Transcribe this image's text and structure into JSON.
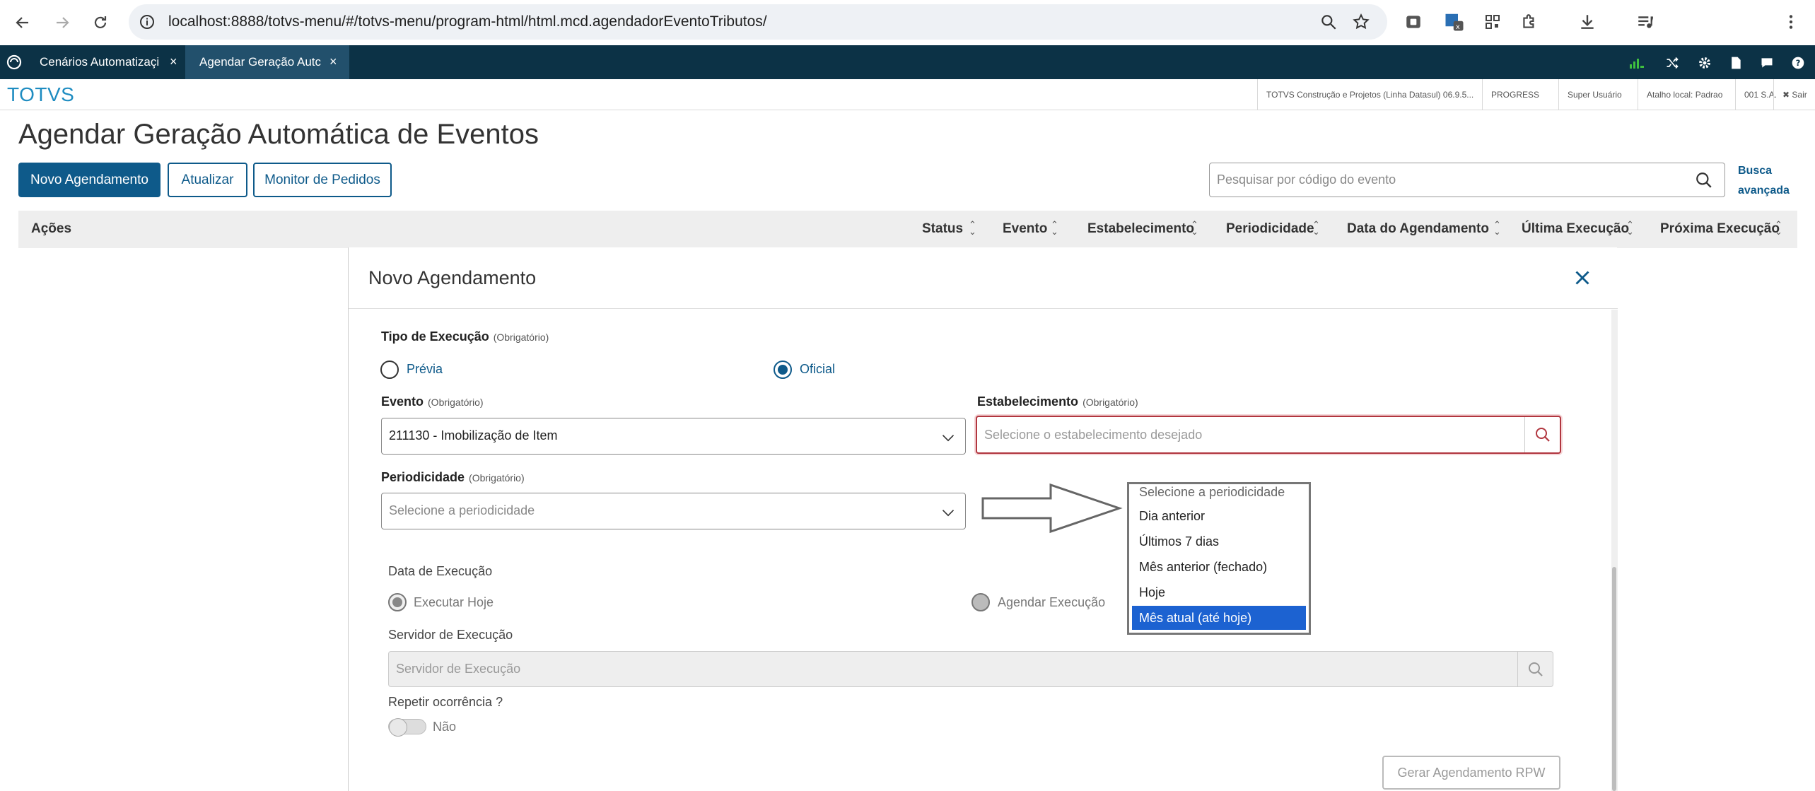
{
  "browser": {
    "url": "localhost:8888/totvs-menu/#/totvs-menu/program-html/html.mcd.agendadorEventoTributos/"
  },
  "app_tabs": [
    {
      "label": "Cenários Automatizaçi",
      "close": "×"
    },
    {
      "label": "Agendar Geração Autc",
      "close": "×"
    }
  ],
  "info_bar": {
    "brand": "TOTVS",
    "items": [
      "TOTVS Construção e Projetos (Linha Datasul) 06.9.5...",
      "PROGRESS",
      "Super Usuário",
      "Atalho local: Padrao",
      "001 S.A.",
      "✖ Sair"
    ]
  },
  "page": {
    "title": "Agendar Geração Automática de Eventos",
    "buttons": {
      "new": "Novo Agendamento",
      "refresh": "Atualizar",
      "monitor": "Monitor de Pedidos"
    },
    "search_placeholder": "Pesquisar por código do evento",
    "advanced_search_line1": "Busca",
    "advanced_search_line2": "avançada"
  },
  "table": {
    "actions_header": "Ações",
    "columns": [
      "Status",
      "Evento",
      "Estabelecimento",
      "Periodicidade",
      "Data do Agendamento",
      "Última Execução",
      "Próxima Execução"
    ]
  },
  "modal": {
    "title": "Novo Agendamento",
    "required_tag": "(Obrigatório)",
    "tipo_label": "Tipo de Execução",
    "tipo_options": [
      "Prévia",
      "Oficial"
    ],
    "tipo_selected": "Oficial",
    "evento_label": "Evento",
    "evento_value": "211130 - Imobilização de Item",
    "estab_label": "Estabelecimento",
    "estab_placeholder": "Selecione o estabelecimento desejado",
    "period_label": "Periodicidade",
    "period_placeholder": "Selecione a periodicidade",
    "data_label": "Data de Execução",
    "data_options": [
      "Executar Hoje",
      "Agendar Execução"
    ],
    "servidor_label": "Servidor de Execução",
    "servidor_placeholder": "Servidor de Execução",
    "repetir_label": "Repetir ocorrência ?",
    "repetir_value": "Não",
    "submit": "Gerar Agendamento RPW"
  },
  "dropdown": {
    "options": [
      "Selecione a periodicidade",
      "Dia anterior",
      "Últimos 7 dias",
      "Mês anterior (fechado)",
      "Hoje",
      "Mês atual (até hoje)"
    ],
    "highlighted": "Mês atual (até hoje)",
    "highlight_color": "#1c62d1"
  },
  "colors": {
    "tabbar": "#0c3246",
    "primary": "#0e5a8a",
    "brand": "#1e8cc1",
    "error": "#b1363f"
  }
}
